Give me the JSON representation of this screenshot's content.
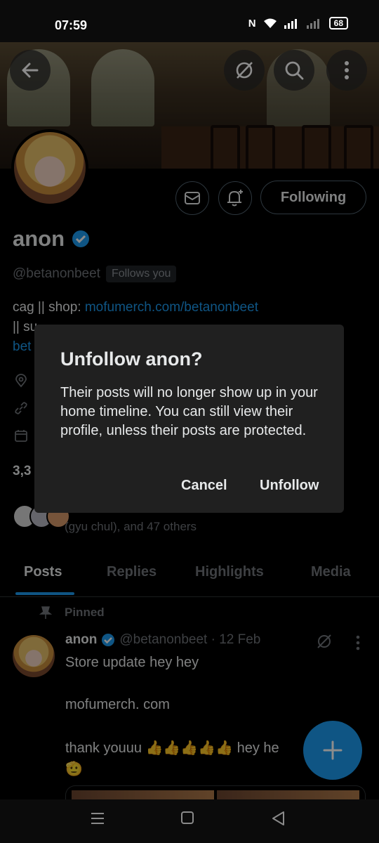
{
  "status_bar": {
    "time": "07:59",
    "nfc": "N",
    "battery": "68"
  },
  "profile": {
    "name": "anon",
    "handle": "@betanonbeet",
    "follows_you": "Follows you",
    "following_label": "Following",
    "bio_prefix": "cag || shop: ",
    "bio_link": "mofumerch.com/betanonbeet",
    "bio_line2_start": "|| su",
    "bio_line3_start": "bet",
    "count_partial": "3,3",
    "followed_by_tail": "(gyu chul), and 47 others"
  },
  "tabs": [
    "Posts",
    "Replies",
    "Highlights",
    "Media"
  ],
  "pinned_label": "Pinned",
  "post": {
    "name": "anon",
    "handle_date": "@betanonbeet · 12 Feb",
    "line1": "Store update hey hey",
    "line2": "mofumerch. com",
    "line3": "thank youuu 👍👍👍👍👍 hey he",
    "line4": "🫡"
  },
  "dialog": {
    "title": "Unfollow anon?",
    "body": "Their posts will no longer show up in your home timeline. You can still view their profile, unless their posts are protected.",
    "cancel": "Cancel",
    "confirm": "Unfollow"
  },
  "colors": {
    "accent": "#1d9bf0",
    "dialog_bg": "#202020",
    "muted": "#71767b"
  }
}
